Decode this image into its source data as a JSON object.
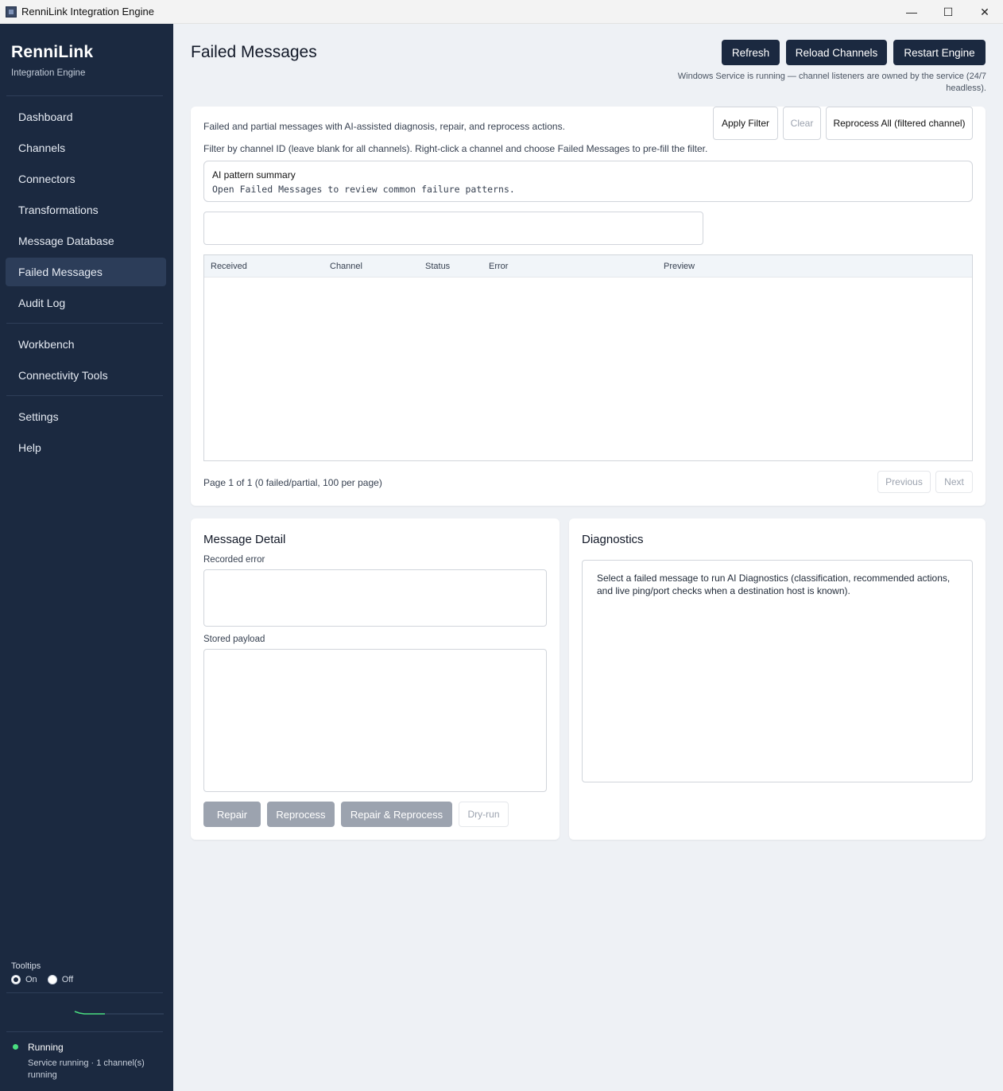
{
  "window": {
    "title": "RenniLink Integration Engine",
    "controls": {
      "minimize": "—",
      "maximize": "☐",
      "close": "✕"
    }
  },
  "sidebar": {
    "brand": "RenniLink",
    "subtitle": "Integration Engine",
    "items": [
      {
        "label": "Dashboard",
        "active": false
      },
      {
        "label": "Channels",
        "active": false
      },
      {
        "label": "Connectors",
        "active": false
      },
      {
        "label": "Transformations",
        "active": false
      },
      {
        "label": "Message Database",
        "active": false
      },
      {
        "label": "Failed Messages",
        "active": true
      },
      {
        "label": "Audit Log",
        "active": false
      },
      {
        "label": "Workbench",
        "active": false
      },
      {
        "label": "Connectivity Tools",
        "active": false
      },
      {
        "label": "Settings",
        "active": false
      },
      {
        "label": "Help",
        "active": false
      }
    ],
    "tooltips": {
      "label": "Tooltips",
      "on": "On",
      "off": "Off",
      "selected": "On"
    },
    "status": {
      "title": "Running",
      "detail": "Service running · 1 channel(s) running",
      "color": "#4ade80"
    }
  },
  "header": {
    "title": "Failed Messages",
    "buttons": {
      "refresh": "Refresh",
      "reload": "Reload Channels",
      "restart": "Restart Engine"
    },
    "service_note": "Windows Service is running — channel listeners are owned by the service (24/7 headless)."
  },
  "failed_panel": {
    "description": "Failed and partial messages with AI-assisted diagnosis, repair, and reprocess actions.",
    "filter_hint": "Filter by channel ID (leave blank for all channels). Right-click a channel and choose Failed Messages to pre-fill the filter.",
    "ai_summary": {
      "title": "AI pattern summary",
      "text": "Open Failed Messages to review common failure patterns."
    },
    "filter": {
      "value": "",
      "apply": "Apply Filter",
      "clear": "Clear",
      "reprocess_all": "Reprocess All (filtered channel)"
    },
    "table": {
      "columns": [
        "Received",
        "Channel",
        "Status",
        "Error",
        "Preview"
      ],
      "rows": []
    },
    "pager": {
      "text": "Page 1 of 1 (0 failed/partial, 100 per page)",
      "previous": "Previous",
      "next": "Next"
    }
  },
  "detail": {
    "title": "Message Detail",
    "recorded_error_label": "Recorded error",
    "recorded_error": "",
    "stored_payload_label": "Stored payload",
    "stored_payload": "",
    "buttons": {
      "repair": "Repair",
      "reprocess": "Reprocess",
      "repair_reprocess": "Repair & Reprocess",
      "dry_run": "Dry-run"
    }
  },
  "diagnostics": {
    "title": "Diagnostics",
    "text": "Select a failed message to run AI Diagnostics (classification, recommended actions, and live ping/port checks when a destination host is known)."
  },
  "colors": {
    "sidebar": "#1b2940",
    "accent": "#1b2940",
    "active_item": "#2c3d59",
    "disabled_button": "#9ca3af"
  }
}
